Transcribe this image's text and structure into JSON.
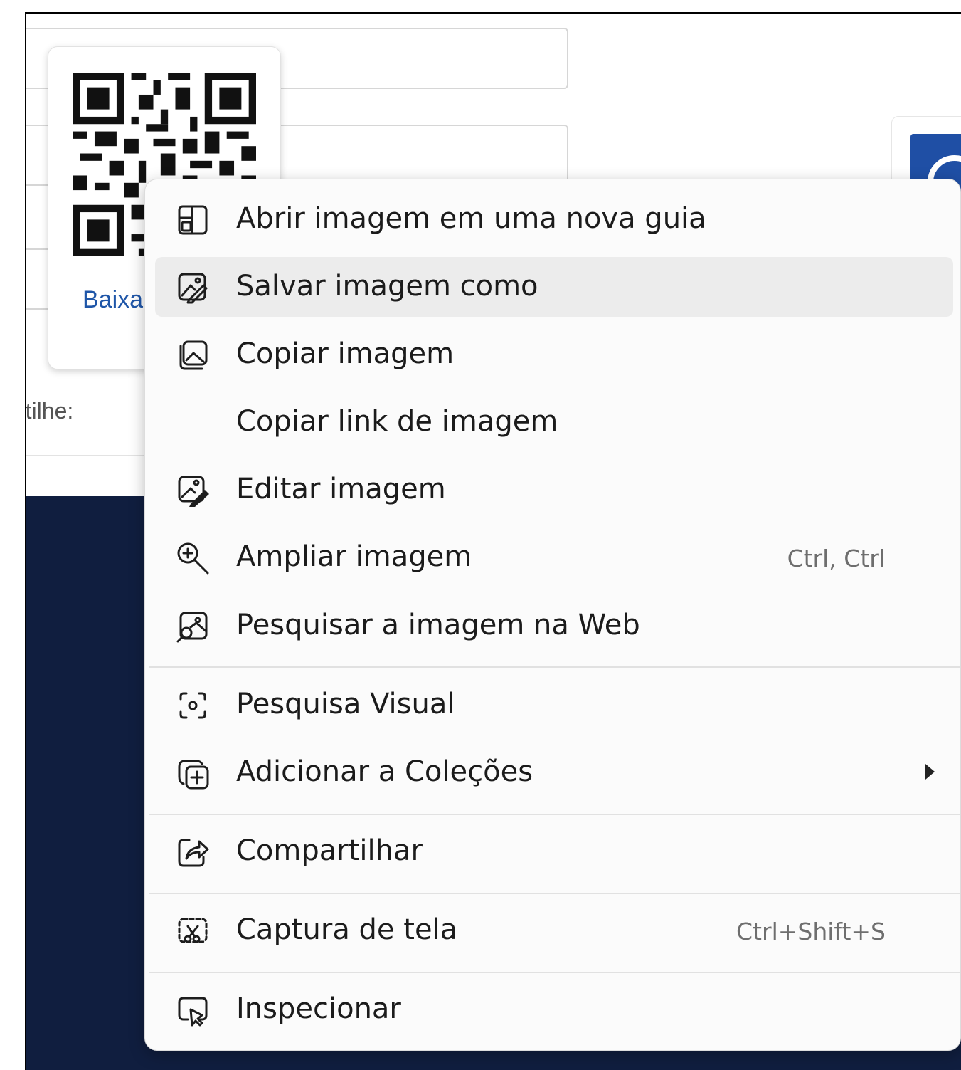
{
  "page": {
    "download_label": "Baixa",
    "share_label": "rtilhe:"
  },
  "context_menu": {
    "items": [
      {
        "label": "Abrir imagem em uma nova guia",
        "icon": "open-image-new-tab-icon"
      },
      {
        "label": "Salvar imagem como",
        "icon": "save-image-icon"
      },
      {
        "label": "Copiar imagem",
        "icon": "copy-image-icon"
      },
      {
        "label": "Copiar link de imagem",
        "icon": ""
      },
      {
        "label": "Editar imagem",
        "icon": "edit-image-icon"
      },
      {
        "label": "Ampliar imagem",
        "icon": "zoom-in-icon",
        "shortcut": "Ctrl, Ctrl"
      },
      {
        "label": "Pesquisar a imagem na Web",
        "icon": "search-image-web-icon"
      },
      {
        "label": "Pesquisa Visual",
        "icon": "visual-search-icon"
      },
      {
        "label": "Adicionar a Coleções",
        "icon": "add-to-collections-icon",
        "submenu": true
      },
      {
        "label": "Compartilhar",
        "icon": "share-icon"
      },
      {
        "label": "Captura de tela",
        "icon": "screenshot-icon",
        "shortcut": "Ctrl+Shift+S"
      },
      {
        "label": "Inspecionar",
        "icon": "inspect-icon"
      }
    ]
  }
}
